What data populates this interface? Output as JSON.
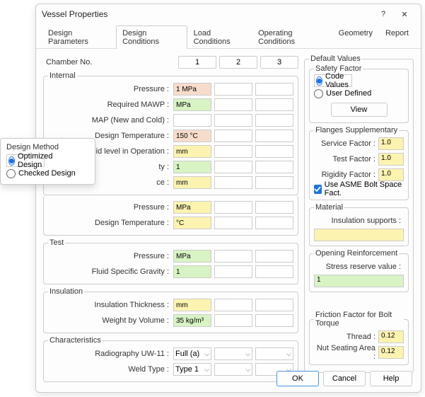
{
  "window": {
    "title": "Vessel Properties",
    "help": "?",
    "close": "✕"
  },
  "tabs": [
    "Design Parameters",
    "Design Conditions",
    "Load Conditions",
    "Operating Conditions",
    "Geometry",
    "Report"
  ],
  "active_tab": 1,
  "chamber": {
    "label": "Chamber No.",
    "headers": [
      "1",
      "2",
      "3"
    ]
  },
  "groups": {
    "internal": "Internal",
    "test": "Test",
    "insulation": "Insulation",
    "characteristics": "Characteristics"
  },
  "rows": {
    "pressure": {
      "label": "Pressure :",
      "v": "1 MPa"
    },
    "mawp": {
      "label": "Required MAWP :",
      "v": "MPa"
    },
    "map": {
      "label": "MAP (New and Cold) :",
      "v": ""
    },
    "dtemp": {
      "label": "Design Temperature :",
      "v": "150 °C"
    },
    "liquid": {
      "label": "Liquid level in Operation :",
      "v": "mm"
    },
    "gravity": {
      "label": "ty :",
      "v": "1"
    },
    "ce": {
      "label": "ce :",
      "v": "mm"
    },
    "pressure2": {
      "label": "Pressure :",
      "v": "MPa"
    },
    "dtemp2": {
      "label": "Design Temperature :",
      "v": "°C"
    },
    "tpressure": {
      "label": "Pressure :",
      "v": "MPa"
    },
    "fsg": {
      "label": "Fluid Specific Gravity :",
      "v": "1"
    },
    "ithick": {
      "label": "Insulation Thickness :",
      "v": "mm"
    },
    "wbv": {
      "label": "Weight by Volume :",
      "v": "35 kg/m³"
    },
    "radio": {
      "label": "Radiography UW-11 :",
      "v": "Full (a)"
    },
    "weld": {
      "label": "Weld Type :",
      "v": "Type 1"
    }
  },
  "right": {
    "default_values": "Default Values",
    "safety_factor": "Safety Factor",
    "code_values": "Code Values",
    "user_defined": "User Defined",
    "view": "View",
    "flanges": "Flanges Supplementary",
    "service": {
      "label": "Service Factor :",
      "v": "1.0"
    },
    "testf": {
      "label": "Test Factor :",
      "v": "1.0"
    },
    "rigidity": {
      "label": "Rigidity Factor :",
      "v": "1.0"
    },
    "asme": "Use ASME Bolt Space Fact.",
    "material": "Material",
    "insulation_supports": "Insulation supports :",
    "opening": "Opening Reinforcement",
    "stress": "Stress reserve value :",
    "stress_v": "1",
    "friction": "Friction Factor for Bolt Torque",
    "thread": {
      "label": "Thread :",
      "v": "0.12"
    },
    "nut": {
      "label": "Nut Seating Area :",
      "v": "0.12"
    }
  },
  "popup": {
    "title": "Design Method",
    "opt1": "Optimized Design",
    "opt2": "Checked Design"
  },
  "footer": {
    "ok": "OK",
    "cancel": "Cancel",
    "help": "Help"
  }
}
